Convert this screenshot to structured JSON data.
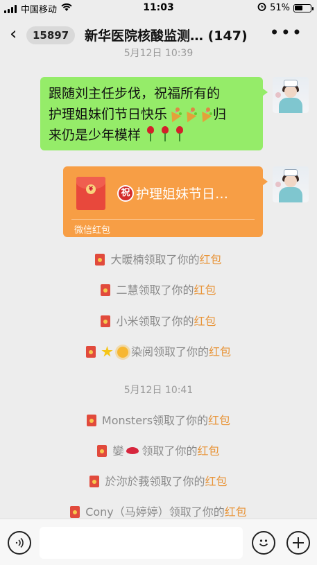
{
  "status_bar": {
    "carrier": "中国移动",
    "time": "11:03",
    "battery": "51%",
    "battery_level": 0.51
  },
  "header": {
    "unread_count": "15897",
    "title": "新华医院核酸监测… (147)"
  },
  "timestamps": {
    "top_partial": "5月12日 10:39",
    "second": "5月12日 10:41"
  },
  "messages": {
    "text_line1": "跟随刘主任步伐，祝福所有的",
    "text_line2_a": "护理姐妹们节日快乐",
    "text_line2_b": "归",
    "text_line3": "来仍是少年模样",
    "red_packet": {
      "badge": "祝",
      "title": "护理姐妹节日…",
      "label": "微信红包",
      "coin": "¥"
    }
  },
  "notices": [
    {
      "name": "大暖楠",
      "action": "领取了你的",
      "link": "红包"
    },
    {
      "name": "二慧",
      "action": "领取了你的",
      "link": "红包"
    },
    {
      "name": "小米",
      "action": "领取了你的",
      "link": "红包"
    },
    {
      "name": "染阅",
      "action": "领取了你的",
      "link": "红包"
    },
    {
      "name": "Monsters",
      "action": "领取了你的",
      "link": "红包"
    },
    {
      "name": "孌",
      "action": "领取了你的",
      "link": "红包"
    },
    {
      "name": "於沵於莪",
      "action": "领取了你的",
      "link": "红包"
    },
    {
      "name": "Cony（马婷婷）",
      "action": "领取了你的",
      "link": "红包"
    }
  ],
  "input_bar": {
    "placeholder": "",
    "emoji_icon": "smiley-icon",
    "plus_icon": "plus-icon",
    "voice_icon": "voice-icon"
  }
}
